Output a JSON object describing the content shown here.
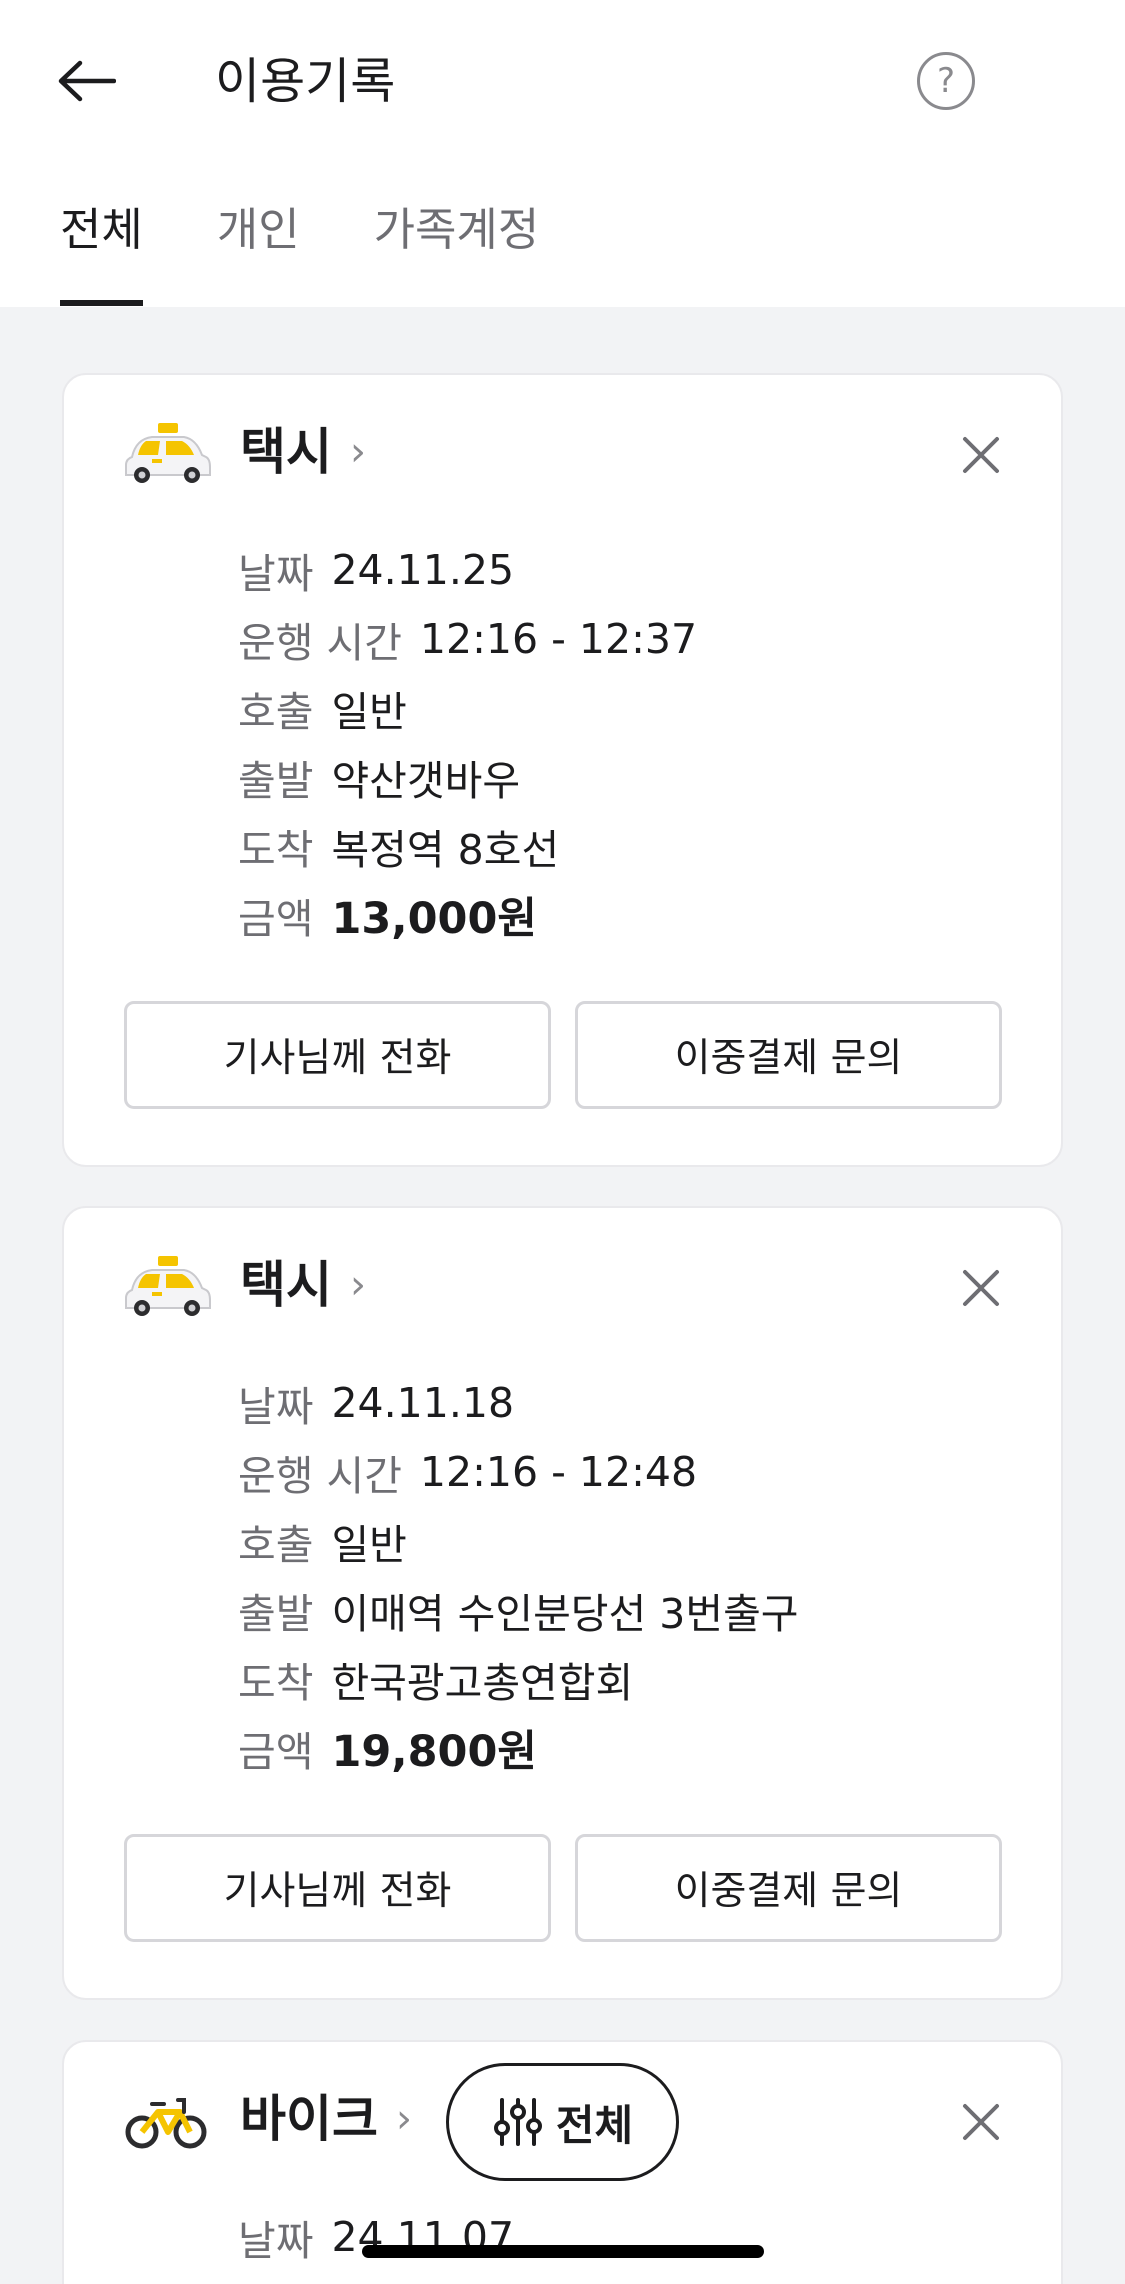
{
  "header": {
    "title": "이용기록"
  },
  "tabs": [
    {
      "label": "전체",
      "active": true
    },
    {
      "label": "개인",
      "active": false
    },
    {
      "label": "가족계정",
      "active": false
    }
  ],
  "records": [
    {
      "service": "택시",
      "icon": "taxi-icon",
      "rows": [
        {
          "k": "날짜",
          "v": "24.11.25"
        },
        {
          "k": "운행 시간",
          "v": "12:16 - 12:37"
        },
        {
          "k": "호출",
          "v": "일반"
        },
        {
          "k": "출발",
          "v": "약산갯바우"
        },
        {
          "k": "도착",
          "v": "복정역 8호선"
        },
        {
          "k": "금액",
          "v": "13,000원"
        }
      ],
      "buttons": [
        "기사님께 전화",
        "이중결제 문의"
      ]
    },
    {
      "service": "택시",
      "icon": "taxi-icon",
      "rows": [
        {
          "k": "날짜",
          "v": "24.11.18"
        },
        {
          "k": "운행 시간",
          "v": "12:16 - 12:48"
        },
        {
          "k": "호출",
          "v": "일반"
        },
        {
          "k": "출발",
          "v": "이매역 수인분당선 3번출구"
        },
        {
          "k": "도착",
          "v": "한국광고총연합회"
        },
        {
          "k": "금액",
          "v": "19,800원"
        }
      ],
      "buttons": [
        "기사님께 전화",
        "이중결제 문의"
      ]
    },
    {
      "service": "바이크",
      "icon": "bike-icon",
      "rows": [
        {
          "k": "날짜",
          "v": "24.11.07"
        }
      ]
    }
  ],
  "filter": {
    "label": "전체"
  },
  "colors": {
    "accent": "#f5c400",
    "text": "#1c1c1e",
    "muted": "#6e6e73",
    "background": "#f2f3f5"
  }
}
